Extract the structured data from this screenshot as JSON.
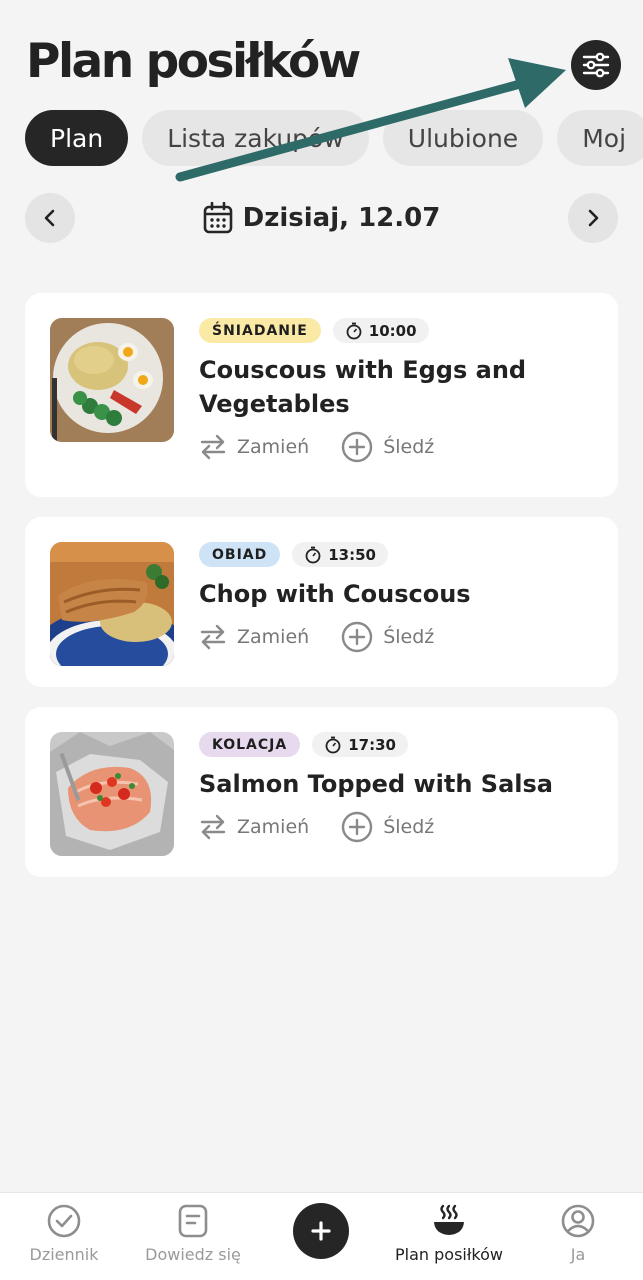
{
  "header": {
    "title": "Plan posiłków",
    "filter_icon": "sliders-icon"
  },
  "tabs": [
    {
      "label": "Plan",
      "active": true
    },
    {
      "label": "Lista zakupów",
      "active": false
    },
    {
      "label": "Ulubione",
      "active": false
    },
    {
      "label": "Moj",
      "active": false
    }
  ],
  "date_nav": {
    "label": "Dzisiaj, 12.07",
    "prev_icon": "chevron-left-icon",
    "next_icon": "chevron-right-icon",
    "calendar_icon": "calendar-icon"
  },
  "meals": [
    {
      "type": "ŚNIADANIE",
      "type_color": "#fbe9a6",
      "time": "10:00",
      "title": "Couscous with Eggs and Vegetables",
      "swap": "Zamień",
      "track": "Śledź"
    },
    {
      "type": "OBIAD",
      "type_color": "#cfe3f6",
      "time": "13:50",
      "title": "Chop with Couscous",
      "swap": "Zamień",
      "track": "Śledź"
    },
    {
      "type": "KOLACJA",
      "type_color": "#e7d9ee",
      "time": "17:30",
      "title": "Salmon Topped with Salsa",
      "swap": "Zamień",
      "track": "Śledź"
    }
  ],
  "bottom_nav": [
    {
      "label": "Dziennik",
      "icon": "check-circle-icon"
    },
    {
      "label": "Dowiedz się",
      "icon": "note-icon"
    },
    {
      "label": "",
      "icon": "plus-icon"
    },
    {
      "label": "Plan posiłków",
      "icon": "bowl-icon",
      "active": true
    },
    {
      "label": "Ja",
      "icon": "user-circle-icon"
    }
  ],
  "colors": {
    "dark": "#262626",
    "background": "#f4f4f4",
    "arrow": "#2d6a68"
  }
}
